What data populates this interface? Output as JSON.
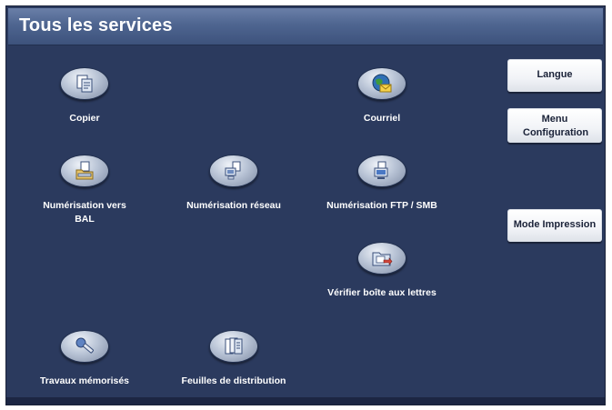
{
  "header": {
    "title": "Tous les services"
  },
  "services": {
    "copier": "Copier",
    "courriel": "Courriel",
    "scan_mailbox": "Numérisation vers BAL",
    "scan_network": "Numérisation réseau",
    "scan_ftp": "Numérisation FTP / SMB",
    "check_mailbox": "Vérifier boîte aux lettres",
    "stored_jobs": "Travaux mémorisés",
    "job_flow": "Feuilles de distribution"
  },
  "side": {
    "language": "Langue",
    "setup_menu": "Menu Configuration",
    "print_mode": "Mode Impression"
  },
  "icons": {
    "copier": "copier-icon",
    "courriel": "email-globe-icon",
    "scan_mailbox": "scan-to-mailbox-icon",
    "scan_network": "network-scan-icon",
    "scan_ftp": "ftp-scan-icon",
    "check_mailbox": "mailbox-folder-icon",
    "stored_jobs": "stored-jobs-icon",
    "job_flow": "job-flow-sheets-icon"
  },
  "colors": {
    "background": "#2b3a5e",
    "title_bar": "#4e6590",
    "button_face": "#f1f3f7"
  }
}
